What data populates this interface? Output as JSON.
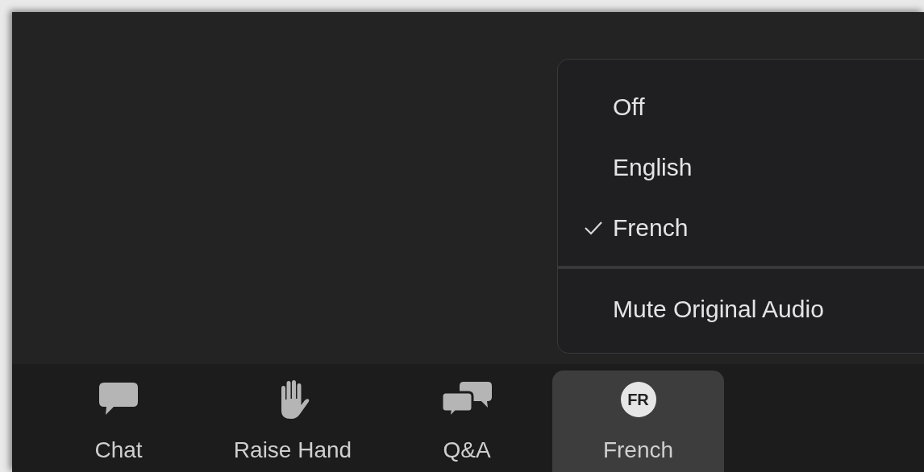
{
  "language_menu": {
    "items": [
      {
        "kind": "option",
        "label": "Off",
        "selected": false
      },
      {
        "kind": "option",
        "label": "English",
        "selected": false
      },
      {
        "kind": "option",
        "label": "French",
        "selected": true
      },
      {
        "kind": "action",
        "label": "Mute Original Audio"
      }
    ]
  },
  "toolbar": {
    "buttons": [
      {
        "kind": "chat",
        "label": "Chat",
        "active": false
      },
      {
        "kind": "raise-hand",
        "label": "Raise Hand",
        "active": false
      },
      {
        "kind": "qa",
        "label": "Q&A",
        "active": false
      },
      {
        "kind": "badge",
        "badge": "FR",
        "label": "French",
        "active": true
      }
    ]
  }
}
